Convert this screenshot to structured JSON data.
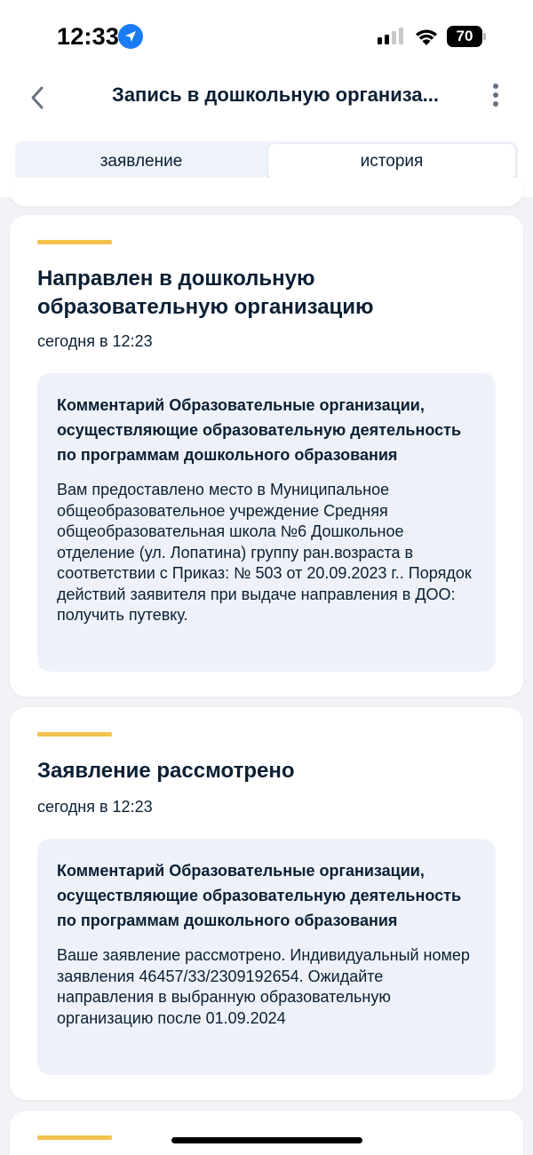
{
  "status_bar": {
    "time": "12:33",
    "battery": "70",
    "icons": [
      "location-arrow-icon",
      "cellular-signal-icon",
      "wifi-icon",
      "battery-icon"
    ]
  },
  "nav": {
    "title": "Запись в дошкольную организа...",
    "back_icon": "chevron-left-icon",
    "more_icon": "more-vertical-icon"
  },
  "tabs": [
    {
      "label": "заявление",
      "selected": false
    },
    {
      "label": "история",
      "selected": true
    }
  ],
  "history": [
    {
      "title": "Направлен в дошкольную образовательную организацию",
      "date": "сегодня в 12:23",
      "comment_title": "Комментарий Образовательные организации, осуществляющие образовательную деятельность по программам дошкольного образования",
      "comment_text": "Вам предоставлено место в Муниципальное общеобразовательное учреждение Средняя общеобразовательная школа №6 Дошкольное отделение (ул. Лопатина) группу ран.возраста в соответствии с Приказ: № 503 от 20.09.2023 г.. Порядок действий заявителя при выдаче направления в ДОО: получить путевку."
    },
    {
      "title": "Заявление рассмотрено",
      "date": "сегодня в 12:23",
      "comment_title": "Комментарий Образовательные организации, осуществляющие образовательную деятельность по программам дошкольного образования",
      "comment_text": "Ваше заявление рассмотрено. Индивидуальный номер заявления 46457/33/2309192654. Ожидайте направления в выбранную образовательную организацию после 01.09.2024"
    }
  ],
  "colors": {
    "accent": "#f4c14b",
    "background": "#f1f3f6",
    "comment_bg": "#eef2f8",
    "text": "#0b1f33",
    "location": "#1a7cf5"
  }
}
